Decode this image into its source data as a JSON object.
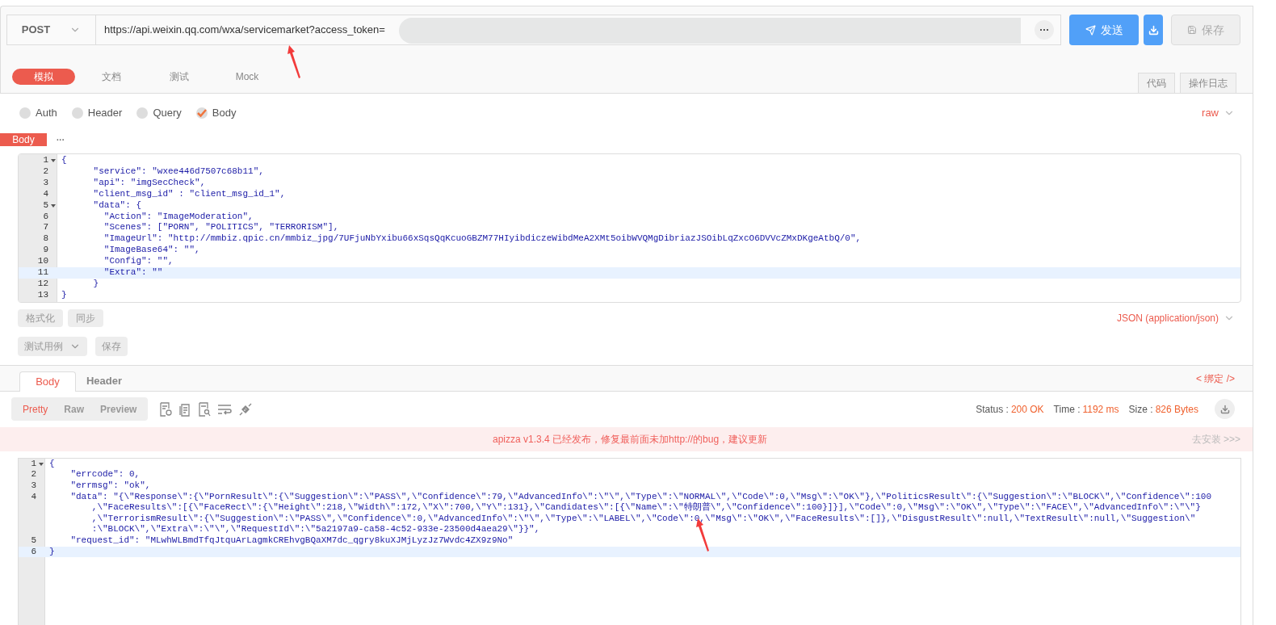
{
  "request": {
    "method": "POST",
    "url": "https://api.weixin.qq.com/wxa/servicemarket?access_token=",
    "send": "发送",
    "save": "保存"
  },
  "modes": [
    {
      "label": "模拟",
      "selected": true
    },
    {
      "label": "文档",
      "selected": false
    },
    {
      "label": "测试",
      "selected": false
    },
    {
      "label": "Mock",
      "selected": false
    }
  ],
  "side_tabs": [
    "代码",
    "操作日志"
  ],
  "params": [
    {
      "label": "Auth",
      "checked": false
    },
    {
      "label": "Header",
      "checked": false
    },
    {
      "label": "Query",
      "checked": false
    },
    {
      "label": "Body",
      "checked": true
    }
  ],
  "body_format": "raw",
  "body_tab": "Body",
  "body_more": "···",
  "request_code": [
    {
      "n": "1",
      "fold": true,
      "text": "{",
      "current": false
    },
    {
      "n": "2",
      "fold": false,
      "text": "      \"service\": \"wxee446d7507c68b11\",",
      "current": false
    },
    {
      "n": "3",
      "fold": false,
      "text": "      \"api\": \"imgSecCheck\",",
      "current": false
    },
    {
      "n": "4",
      "fold": false,
      "text": "      \"client_msg_id\" : \"client_msg_id_1\",",
      "current": false
    },
    {
      "n": "5",
      "fold": true,
      "text": "      \"data\": {",
      "current": false
    },
    {
      "n": "6",
      "fold": false,
      "text": "        \"Action\": \"ImageModeration\",",
      "current": false
    },
    {
      "n": "7",
      "fold": false,
      "text": "        \"Scenes\": [\"PORN\", \"POLITICS\", \"TERRORISM\"],",
      "current": false
    },
    {
      "n": "8",
      "fold": false,
      "text": "        \"ImageUrl\": \"http://mmbiz.qpic.cn/mmbiz_jpg/7UFjuNbYxibu66xSqsQqKcuoGBZM77HIyibdiczeWibdMeA2XMt5oibWVQMgDibriazJSOibLqZxcO6DVVcZMxDKgeAtbQ/0\",",
      "current": false
    },
    {
      "n": "9",
      "fold": false,
      "text": "        \"ImageBase64\": \"\",",
      "current": false
    },
    {
      "n": "10",
      "fold": false,
      "text": "        \"Config\": \"\",",
      "current": false
    },
    {
      "n": "11",
      "fold": false,
      "text": "        \"Extra\": \"\"",
      "current": true
    },
    {
      "n": "12",
      "fold": false,
      "text": "      }",
      "current": false
    },
    {
      "n": "13",
      "fold": false,
      "text": "}",
      "current": false
    }
  ],
  "editor_buttons": [
    "格式化",
    "同步"
  ],
  "content_type": "JSON (application/json)",
  "test_case": "测试用例",
  "test_save": "保存",
  "response_tabs": [
    {
      "label": "Body",
      "selected": true
    },
    {
      "label": "Header",
      "selected": false
    }
  ],
  "bind": "< 绑定 />",
  "views": [
    {
      "label": "Pretty",
      "selected": true
    },
    {
      "label": "Raw",
      "selected": false
    },
    {
      "label": "Preview",
      "selected": false
    }
  ],
  "status": {
    "status_label": "Status :",
    "status": "200 OK",
    "time_label": "Time :",
    "time": "1192 ms",
    "size_label": "Size :",
    "size": "826 Bytes"
  },
  "notice": {
    "text": "apizza v1.3.4 已经发布，修复最前面未加http://的bug，建议更新",
    "action": "去安装 >>>"
  },
  "response_code": [
    {
      "n": "1",
      "fold": true,
      "lines": [
        "{"
      ],
      "current": false
    },
    {
      "n": "2",
      "fold": false,
      "lines": [
        "    \"errcode\": 0,"
      ],
      "current": false
    },
    {
      "n": "3",
      "fold": false,
      "lines": [
        "    \"errmsg\": \"ok\","
      ],
      "current": false
    },
    {
      "n": "4",
      "fold": false,
      "lines": [
        "    \"data\": \"{\\\"Response\\\":{\\\"PornResult\\\":{\\\"Suggestion\\\":\\\"PASS\\\",\\\"Confidence\\\":79,\\\"AdvancedInfo\\\":\\\"\\\",\\\"Type\\\":\\\"NORMAL\\\",\\\"Code\\\":0,\\\"Msg\\\":\\\"OK\\\"},\\\"PoliticsResult\\\":{\\\"Suggestion\\\":\\\"BLOCK\\\",\\\"Confidence\\\":100",
        "        ,\\\"FaceResults\\\":[{\\\"FaceRect\\\":{\\\"Height\\\":218,\\\"Width\\\":172,\\\"X\\\":700,\\\"Y\\\":131},\\\"Candidates\\\":[{\\\"Name\\\":\\\"特朗普\\\",\\\"Confidence\\\":100}]}],\\\"Code\\\":0,\\\"Msg\\\":\\\"OK\\\",\\\"Type\\\":\\\"FACE\\\",\\\"AdvancedInfo\\\":\\\"\\\"}",
        "        ,\\\"TerrorismResult\\\":{\\\"Suggestion\\\":\\\"PASS\\\",\\\"Confidence\\\":0,\\\"AdvancedInfo\\\":\\\"\\\",\\\"Type\\\":\\\"LABEL\\\",\\\"Code\\\":0,\\\"Msg\\\":\\\"OK\\\",\\\"FaceResults\\\":[]},\\\"DisgustResult\\\":null,\\\"TextResult\\\":null,\\\"Suggestion\\\"",
        "        :\\\"BLOCK\\\",\\\"Extra\\\":\\\"\\\",\\\"RequestId\\\":\\\"5a2197a9-ca58-4c52-933e-23500d4aea29\\\"}}\","
      ],
      "current": false
    },
    {
      "n": "5",
      "fold": false,
      "lines": [
        "    \"request_id\": \"MLwhWLBmdTfqJtquArLagmkCREhvgBQaXM7dc_qgry8kuXJMjLyzJz7Wvdc4ZX9z9No\""
      ],
      "current": false
    },
    {
      "n": "6",
      "fold": false,
      "lines": [
        "}"
      ],
      "current": true
    }
  ]
}
